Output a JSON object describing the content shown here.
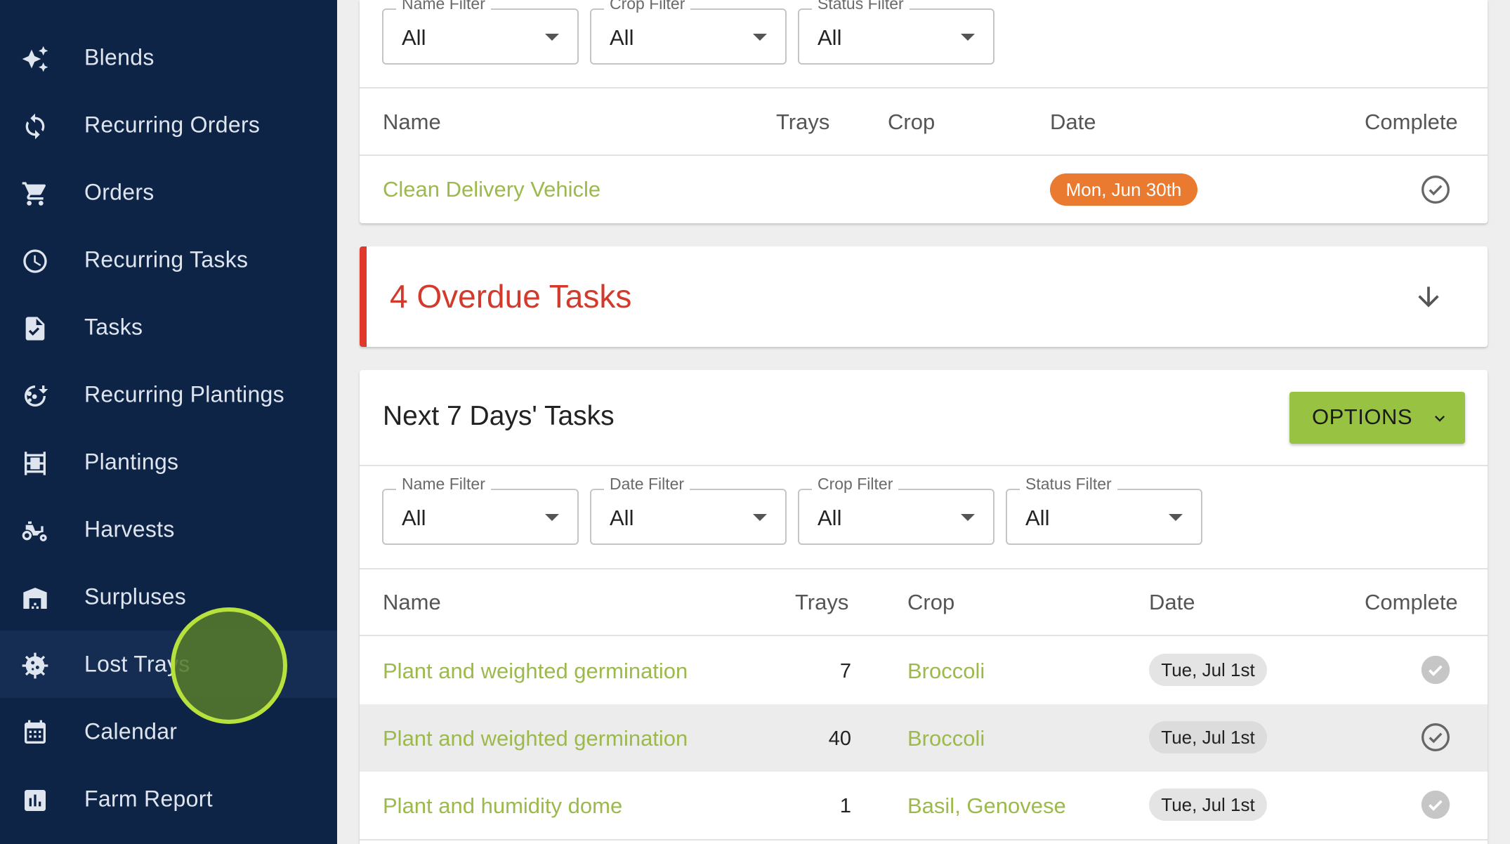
{
  "sidebar": {
    "items": [
      {
        "label": "Blends",
        "icon": "sparkles-icon"
      },
      {
        "label": "Recurring Orders",
        "icon": "sync-icon"
      },
      {
        "label": "Orders",
        "icon": "cart-icon"
      },
      {
        "label": "Recurring Tasks",
        "icon": "clock-icon"
      },
      {
        "label": "Tasks",
        "icon": "task-document-icon"
      },
      {
        "label": "Recurring Plantings",
        "icon": "seed-cycle-icon"
      },
      {
        "label": "Plantings",
        "icon": "tray-rack-icon"
      },
      {
        "label": "Harvests",
        "icon": "tractor-icon"
      },
      {
        "label": "Surpluses",
        "icon": "warehouse-icon"
      },
      {
        "label": "Lost Trays",
        "icon": "virus-icon"
      },
      {
        "label": "Calendar",
        "icon": "calendar-icon"
      },
      {
        "label": "Farm Report",
        "icon": "bar-chart-icon"
      }
    ]
  },
  "today_tasks": {
    "filters": [
      {
        "label": "Name Filter",
        "value": "All"
      },
      {
        "label": "Crop Filter",
        "value": "All"
      },
      {
        "label": "Status Filter",
        "value": "All"
      }
    ],
    "columns": {
      "name": "Name",
      "trays": "Trays",
      "crop": "Crop",
      "date": "Date",
      "complete": "Complete"
    },
    "rows": [
      {
        "name": "Clean Delivery Vehicle",
        "trays": "",
        "crop": "",
        "date": "Mon, Jun 30th",
        "date_color": "#e97a2f"
      }
    ]
  },
  "overdue": {
    "title": "4 Overdue Tasks"
  },
  "next7": {
    "title": "Next 7 Days' Tasks",
    "options_label": "OPTIONS",
    "filters": [
      {
        "label": "Name Filter",
        "value": "All"
      },
      {
        "label": "Date Filter",
        "value": "All"
      },
      {
        "label": "Crop Filter",
        "value": "All"
      },
      {
        "label": "Status Filter",
        "value": "All"
      }
    ],
    "columns": {
      "name": "Name",
      "trays": "Trays",
      "crop": "Crop",
      "date": "Date",
      "complete": "Complete"
    },
    "rows": [
      {
        "name": "Plant and weighted germination",
        "trays": "7",
        "crop": "Broccoli",
        "date": "Tue, Jul 1st",
        "complete_style": "filled"
      },
      {
        "name": "Plant and weighted germination",
        "trays": "40",
        "crop": "Broccoli",
        "date": "Tue, Jul 1st",
        "complete_style": "outlined"
      },
      {
        "name": "Plant and humidity dome",
        "trays": "1",
        "crop": "Basil, Genovese",
        "date": "Tue, Jul 1st",
        "complete_style": "filled"
      }
    ]
  },
  "colors": {
    "sidebar_bg": "#0e2446",
    "link_green": "#9cba4c",
    "overdue_red": "#d33a2c",
    "options_green": "#98c242",
    "chip_orange": "#e97a2f"
  }
}
